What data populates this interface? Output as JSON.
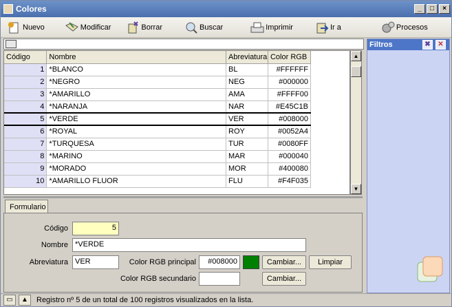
{
  "window": {
    "title": "Colores"
  },
  "toolbar": {
    "nuevo": "Nuevo",
    "modificar": "Modificar",
    "borrar": "Borrar",
    "buscar": "Buscar",
    "imprimir": "Imprimir",
    "ira": "Ir a",
    "procesos": "Procesos"
  },
  "grid": {
    "headers": [
      "Código",
      "Nombre",
      "Abreviatura",
      "Color RGB"
    ],
    "rows": [
      {
        "code": "1",
        "name": "*BLANCO",
        "abbr": "BL",
        "rgb": "#FFFFFF"
      },
      {
        "code": "2",
        "name": "*NEGRO",
        "abbr": "NEG",
        "rgb": "#000000"
      },
      {
        "code": "3",
        "name": "*AMARILLO",
        "abbr": "AMA",
        "rgb": "#FFFF00"
      },
      {
        "code": "4",
        "name": "*NARANJA",
        "abbr": "NAR",
        "rgb": "#E45C1B"
      },
      {
        "code": "5",
        "name": "*VERDE",
        "abbr": "VER",
        "rgb": "#008000"
      },
      {
        "code": "6",
        "name": "*ROYAL",
        "abbr": "ROY",
        "rgb": "#0052A4"
      },
      {
        "code": "7",
        "name": "*TURQUESA",
        "abbr": "TUR",
        "rgb": "#0080FF"
      },
      {
        "code": "8",
        "name": "*MARINO",
        "abbr": "MAR",
        "rgb": "#000040"
      },
      {
        "code": "9",
        "name": "*MORADO",
        "abbr": "MOR",
        "rgb": "#400080"
      },
      {
        "code": "10",
        "name": "*AMARILLO FLUOR",
        "abbr": "FLU",
        "rgb": "#F4F035"
      }
    ]
  },
  "tab": {
    "label": "Formulario"
  },
  "form": {
    "codigo_label": "Código",
    "codigo_value": "5",
    "nombre_label": "Nombre",
    "nombre_value": "*VERDE",
    "abrev_label": "Abreviatura",
    "abrev_value": "VER",
    "rgb_principal_label": "Color RGB principal",
    "rgb_principal_value": "#008000",
    "rgb_secundario_label": "Color RGB secundario",
    "rgb_secundario_value": "",
    "cambiar1": "Cambiar...",
    "limpiar": "Limpiar",
    "cambiar2": "Cambiar...",
    "swatch_color": "#008000"
  },
  "filtros": {
    "title": "Filtros"
  },
  "status": {
    "text": "Registro nº 5 de un total de 100 registros visualizados en la lista."
  }
}
